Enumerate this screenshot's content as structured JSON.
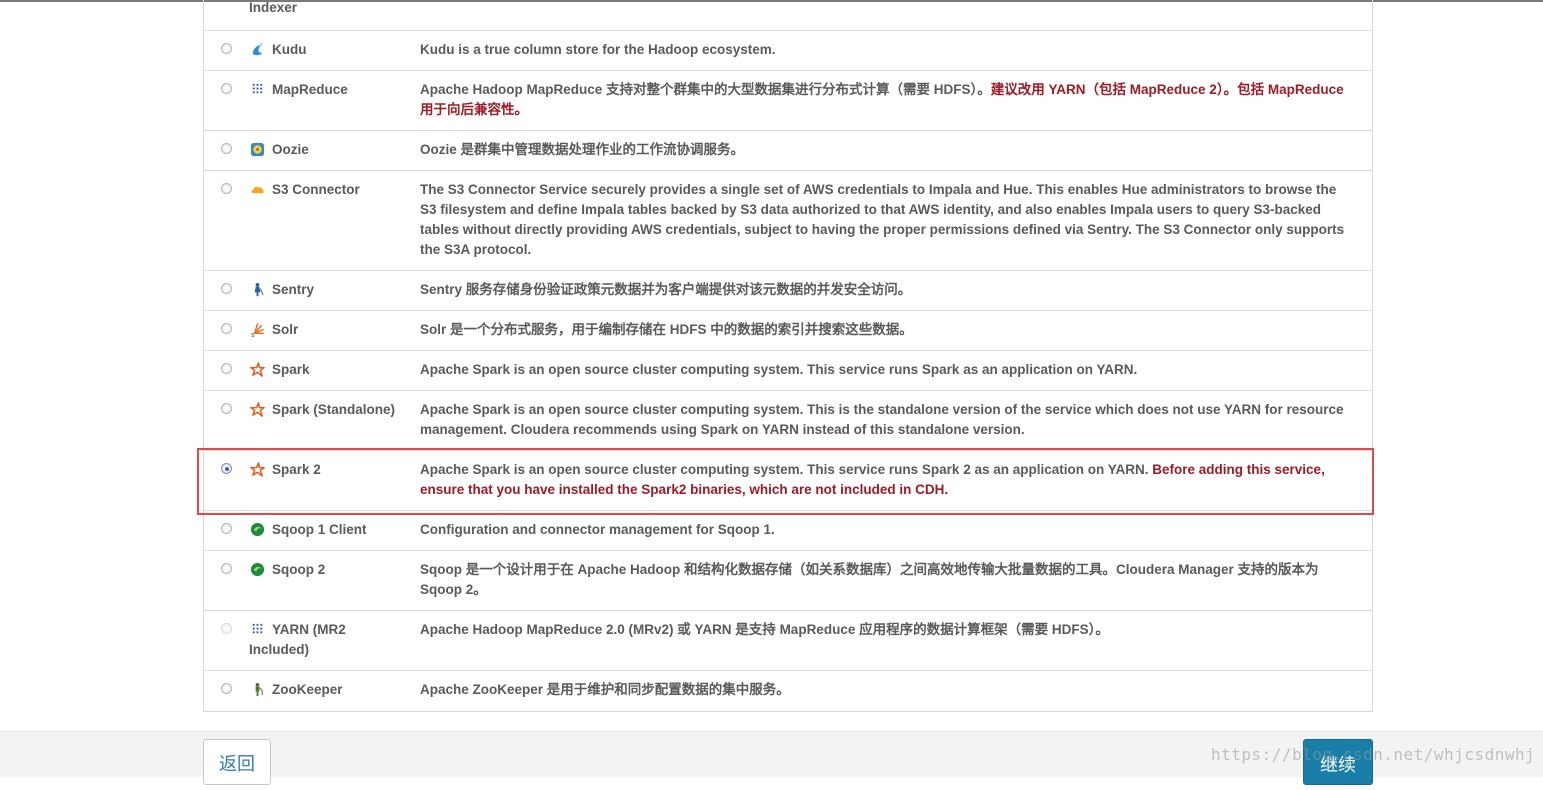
{
  "services": [
    {
      "name": "Indexer",
      "description": "",
      "icon": "",
      "selected": false
    },
    {
      "name": "Kudu",
      "description": "Kudu is a true column store for the Hadoop ecosystem.",
      "icon": "kudu-icon",
      "selected": false
    },
    {
      "name": "MapReduce",
      "description": "Apache Hadoop MapReduce 支持对整个群集中的大型数据集进行分布式计算（需要 HDFS）。",
      "warning": "建议改用 YARN（包括 MapReduce 2）。包括 MapReduce 用于向后兼容性。",
      "icon": "mapreduce-icon",
      "selected": false
    },
    {
      "name": "Oozie",
      "description": "Oozie 是群集中管理数据处理作业的工作流协调服务。",
      "icon": "oozie-icon",
      "selected": false
    },
    {
      "name": "S3 Connector",
      "description": "The S3 Connector Service securely provides a single set of AWS credentials to Impala and Hue. This enables Hue administrators to browse the S3 filesystem and define Impala tables backed by S3 data authorized to that AWS identity, and also enables Impala users to query S3-backed tables without directly providing AWS credentials, subject to having the proper permissions defined via Sentry. The S3 Connector only supports the S3A protocol.",
      "icon": "cloud-icon",
      "selected": false
    },
    {
      "name": "Sentry",
      "description": "Sentry 服务存储身份验证政策元数据并为客户端提供对该元数据的并发安全访问。",
      "icon": "sentry-icon",
      "selected": false
    },
    {
      "name": "Solr",
      "description": "Solr 是一个分布式服务，用于编制存储在 HDFS 中的数据的索引并搜索这些数据。",
      "icon": "solr-icon",
      "selected": false
    },
    {
      "name": "Spark",
      "description": "Apache Spark is an open source cluster computing system. This service runs Spark as an application on YARN.",
      "icon": "spark-icon",
      "selected": false
    },
    {
      "name": "Spark (Standalone)",
      "description": "Apache Spark is an open source cluster computing system. This is the standalone version of the service which does not use YARN for resource management. Cloudera recommends using Spark on YARN instead of this standalone version.",
      "icon": "spark-icon",
      "selected": false
    },
    {
      "name": "Spark 2",
      "description": "Apache Spark is an open source cluster computing system. This service runs Spark 2 as an application on YARN.",
      "warning": "Before adding this service, ensure that you have installed the Spark2 binaries, which are not included in CDH.",
      "icon": "spark-icon",
      "selected": true
    },
    {
      "name": "Sqoop 1 Client",
      "description": "Configuration and connector management for Sqoop 1.",
      "icon": "sqoop-icon",
      "selected": false
    },
    {
      "name": "Sqoop 2",
      "description": "Sqoop 是一个设计用于在 Apache Hadoop 和结构化数据存储（如关系数据库）之间高效地传输大批量数据的工具。Cloudera Manager 支持的版本为 Sqoop 2。",
      "icon": "sqoop-icon",
      "selected": false
    },
    {
      "name": "YARN (MR2 Included)",
      "description": "Apache Hadoop MapReduce 2.0 (MRv2) 或 YARN 是支持 MapReduce 应用程序的数据计算框架（需要 HDFS）。",
      "icon": "yarn-icon",
      "selected": false,
      "disabled": true
    },
    {
      "name": "ZooKeeper",
      "description": "Apache ZooKeeper 是用于维护和同步配置数据的集中服务。",
      "icon": "zookeeper-icon",
      "selected": false
    }
  ],
  "footer": {
    "back_label": "返回",
    "continue_label": "继续"
  },
  "watermark": "https://blog.csdn.net/whjcsdnwhj",
  "colors": {
    "warning": "#9b1c26",
    "highlight_border": "#e34848",
    "primary_button": "#1a7fa8"
  }
}
